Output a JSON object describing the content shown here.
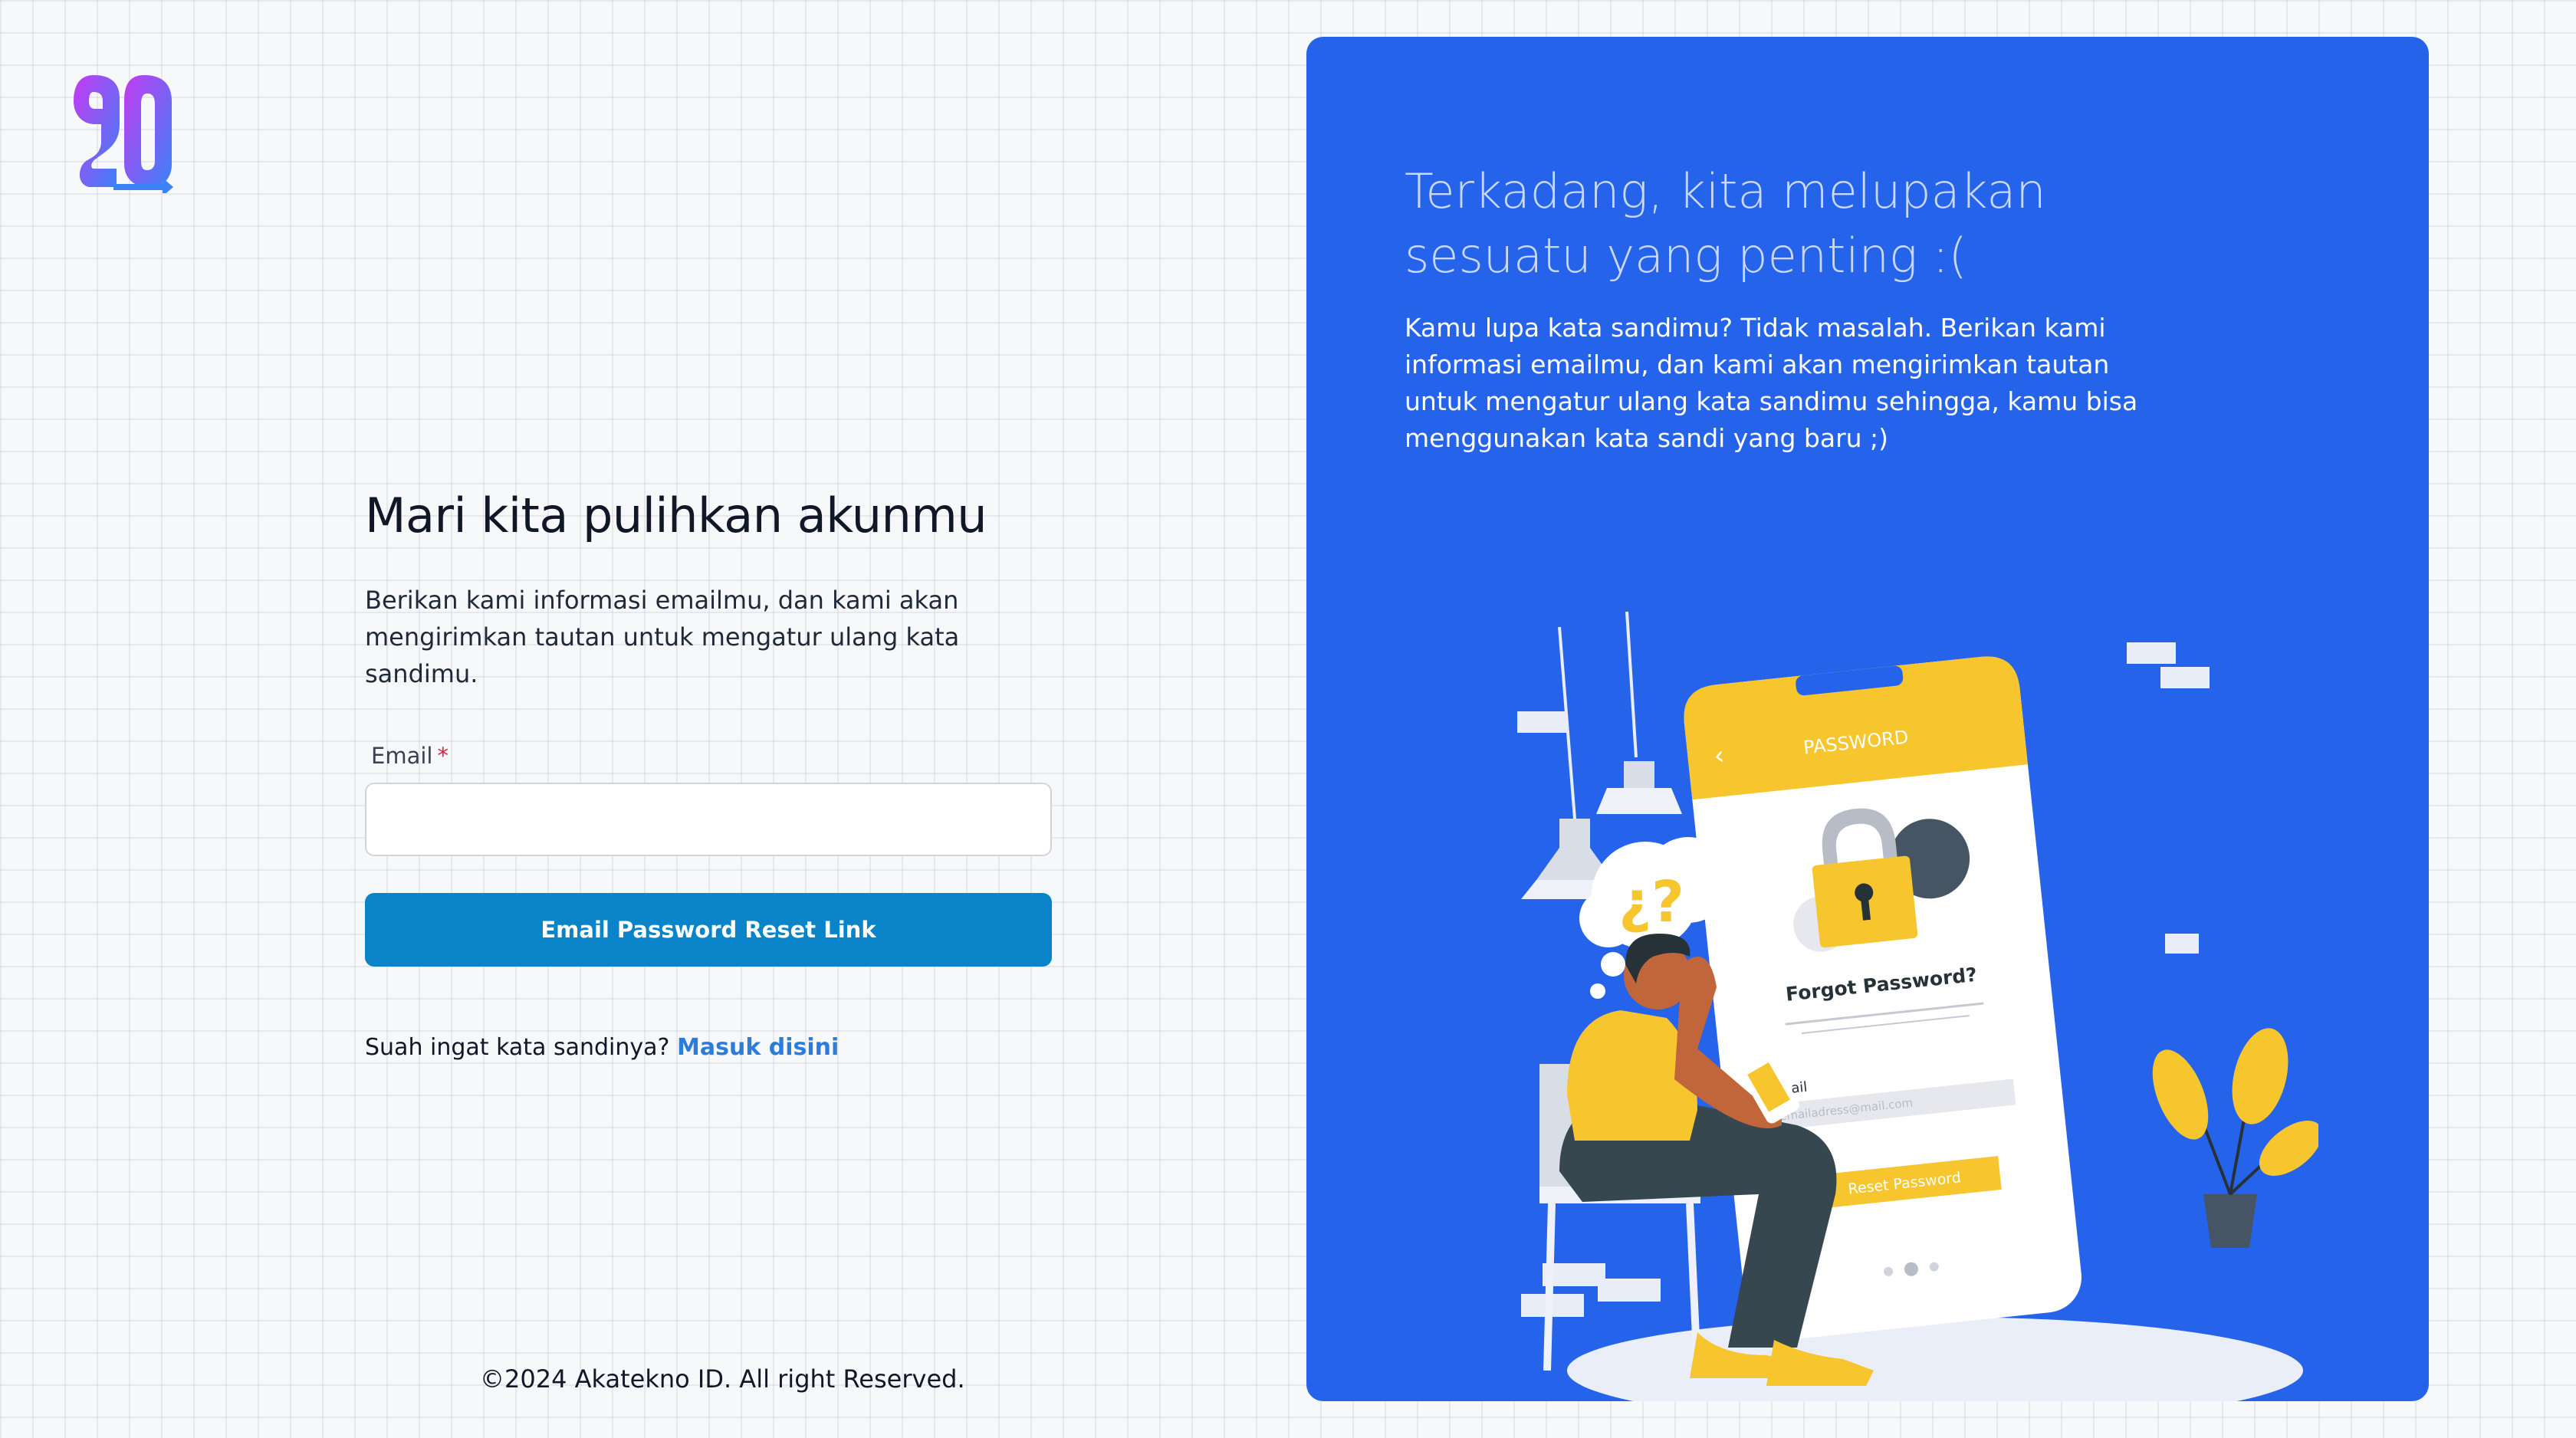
{
  "brand": {
    "logo_icon": "akatekno-logo-icon",
    "accent_from": "#c33bf2",
    "accent_to": "#3b82f6"
  },
  "form": {
    "title": "Mari kita pulihkan akunmu",
    "subtitle": "Berikan kami informasi emailmu, dan kami akan mengirimkan tautan untuk mengatur ulang kata sandimu.",
    "email_label": "Email",
    "required_mark": "*",
    "email_value": "",
    "email_placeholder": "",
    "submit_label": "Email Password Reset Link",
    "remember_text": "Suah ingat kata sandinya?",
    "login_link": "Masuk disini"
  },
  "footer": {
    "copyright": "©2024 Akatekno ID. All right Reserved."
  },
  "hero": {
    "heading": "Terkadang, kita melupakan sesuatu yang penting :(",
    "text": "Kamu lupa kata sandimu? Tidak masalah. Berikan kami informasi emailmu, dan kami akan mengirimkan tautan untuk mengatur ulang kata sandimu sehingga, kamu bisa menggunakan kata sandi yang baru ;)",
    "background": "#2563eb"
  },
  "illustration": {
    "phone_header": "PASSWORD",
    "phone_title": "Forgot Password?",
    "phone_email_label": "Email",
    "phone_email_placeholder": "emailadress@mail.com",
    "phone_button": "Reset Password",
    "thought_bubble": "¿?",
    "accent": "#f7c52d"
  }
}
